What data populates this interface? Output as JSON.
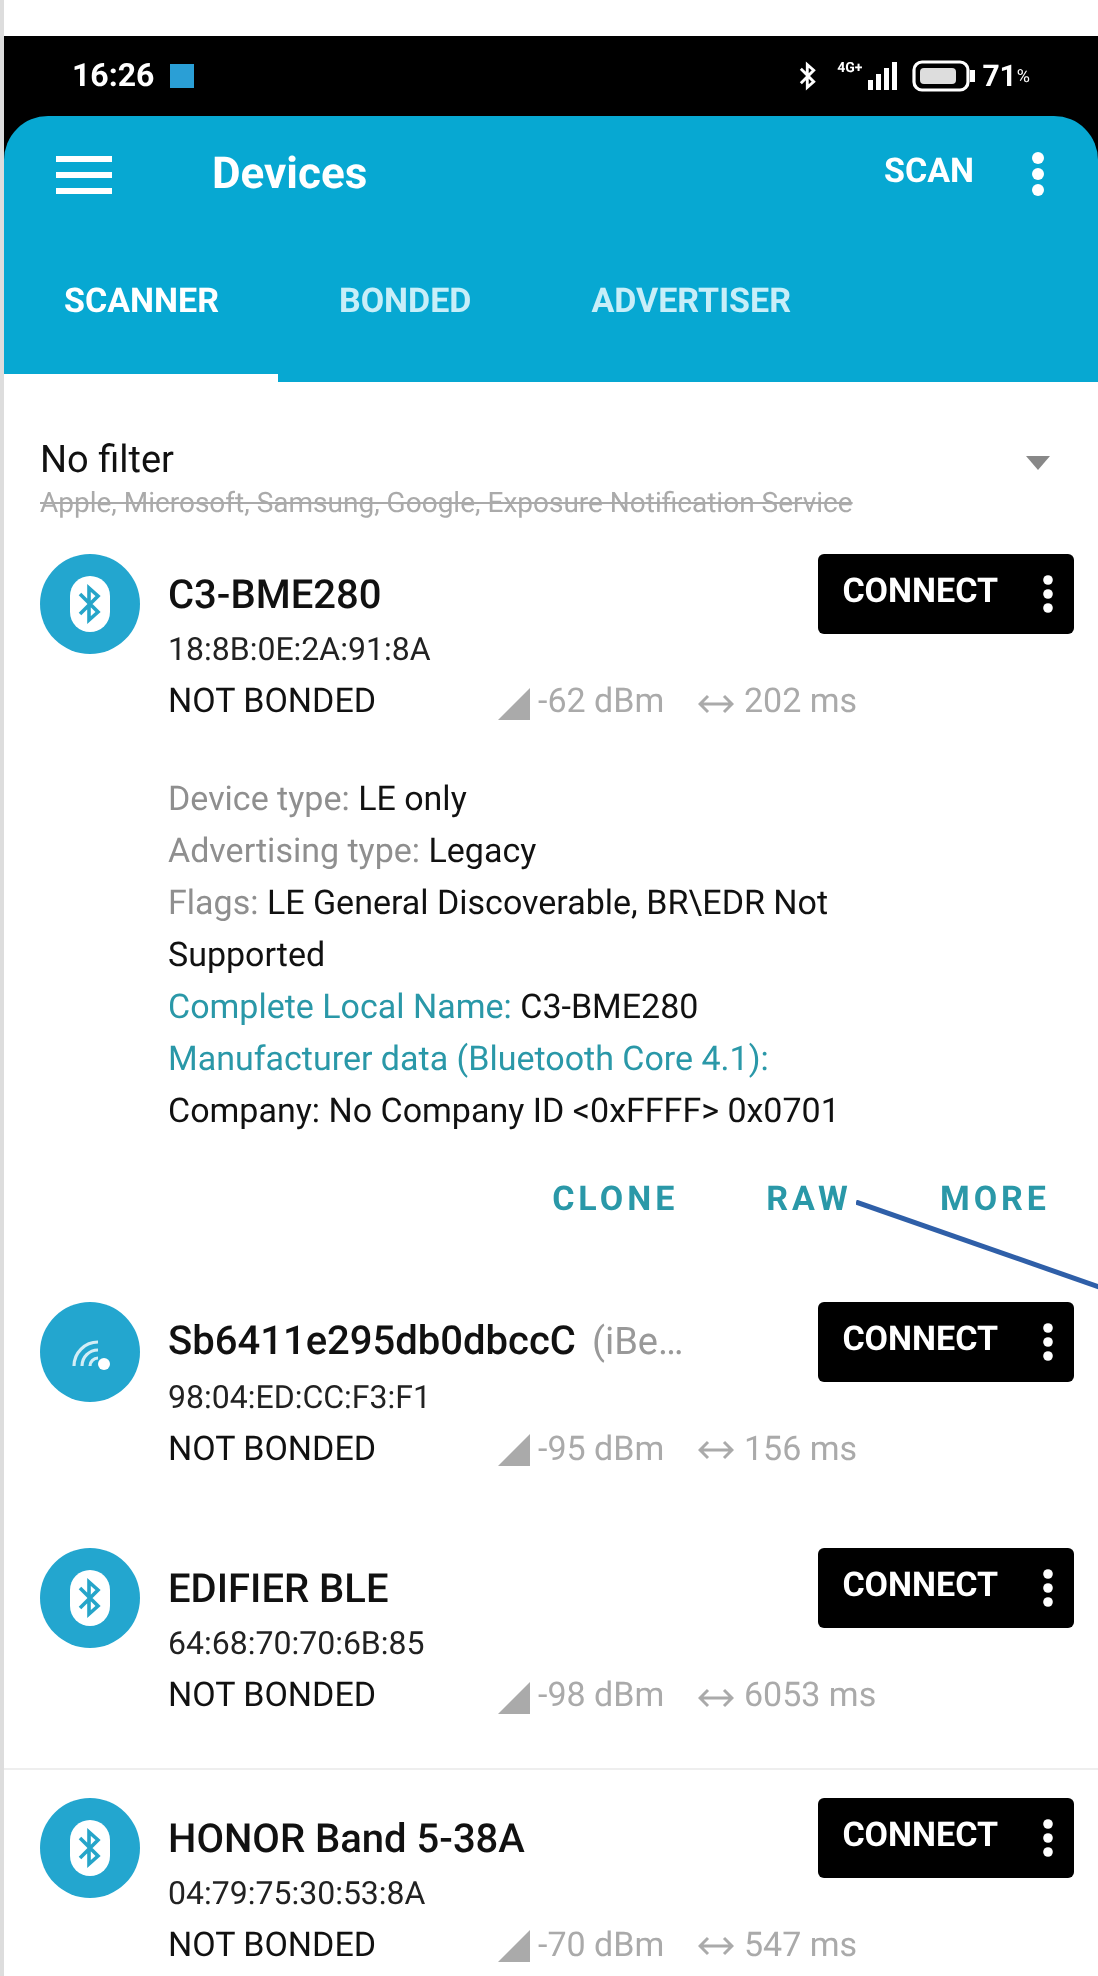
{
  "status_bar": {
    "time": "16:26",
    "network": "4G+",
    "battery": "71",
    "battery_unit": "%"
  },
  "app_bar": {
    "title": "Devices",
    "action": "SCAN"
  },
  "tabs": [
    {
      "label": "SCANNER",
      "selected": true
    },
    {
      "label": "BONDED",
      "selected": false
    },
    {
      "label": "ADVERTISER",
      "selected": false
    }
  ],
  "filter": {
    "title": "No filter",
    "excluded": "Apple, Microsoft, Samsung, Google, Exposure Notification Service"
  },
  "devices": [
    {
      "kind": "bluetooth",
      "name": "C3-BME280",
      "address": "18:8B:0E:2A:91:8A",
      "bond": "NOT BONDED",
      "rssi": "-62 dBm",
      "interval": "202 ms",
      "button": "CONNECT",
      "expanded": true,
      "details": [
        {
          "kind": "info",
          "label": "Device type:",
          "value": "LE only"
        },
        {
          "kind": "info",
          "label": "Advertising type:",
          "value": "Legacy"
        },
        {
          "kind": "info",
          "label": "Flags:",
          "value": "LE General Discoverable, BR\\EDR Not Supported"
        },
        {
          "kind": "record",
          "label": "Complete Local Name:",
          "value": "C3-BME280"
        },
        {
          "kind": "record-block",
          "label": "Manufacturer data (Bluetooth Core 4.1):",
          "value": "Company: No Company ID <0xFFFF> 0x0701"
        }
      ],
      "actions": [
        "CLONE",
        "RAW",
        "MORE"
      ]
    },
    {
      "kind": "beacon",
      "name": "Sb6411e295db0dbccC",
      "name_suffix": "(iBe…",
      "address": "98:04:ED:CC:F3:F1",
      "bond": "NOT BONDED",
      "rssi": "-95 dBm",
      "interval": "156 ms",
      "button": "CONNECT",
      "expanded": false
    },
    {
      "kind": "bluetooth",
      "name": "EDIFIER BLE",
      "address": "64:68:70:70:6B:85",
      "bond": "NOT BONDED",
      "rssi": "-98 dBm",
      "interval": "6053 ms",
      "button": "CONNECT",
      "expanded": false
    },
    {
      "kind": "bluetooth",
      "name": "HONOR Band 5-38A",
      "address": "04:79:75:30:53:8A",
      "bond": "NOT BONDED",
      "rssi": "-70 dBm",
      "interval": "547 ms",
      "button": "CONNECT",
      "expanded": false
    }
  ]
}
